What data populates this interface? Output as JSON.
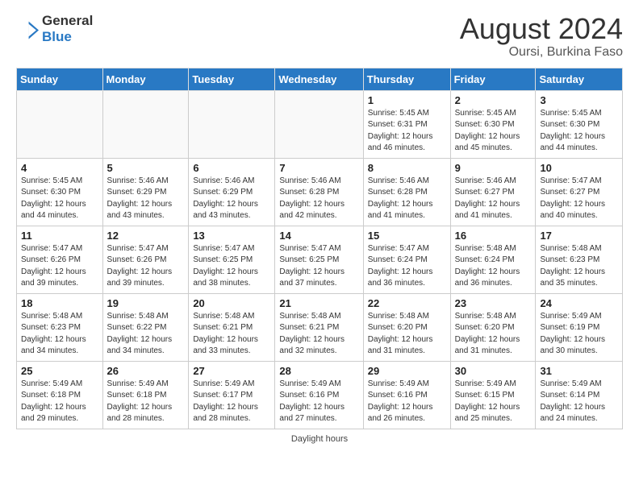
{
  "logo": {
    "line1": "General",
    "line2": "Blue"
  },
  "title": "August 2024",
  "location": "Oursi, Burkina Faso",
  "weekdays": [
    "Sunday",
    "Monday",
    "Tuesday",
    "Wednesday",
    "Thursday",
    "Friday",
    "Saturday"
  ],
  "weeks": [
    [
      {
        "day": "",
        "info": ""
      },
      {
        "day": "",
        "info": ""
      },
      {
        "day": "",
        "info": ""
      },
      {
        "day": "",
        "info": ""
      },
      {
        "day": "1",
        "info": "Sunrise: 5:45 AM\nSunset: 6:31 PM\nDaylight: 12 hours\nand 46 minutes."
      },
      {
        "day": "2",
        "info": "Sunrise: 5:45 AM\nSunset: 6:30 PM\nDaylight: 12 hours\nand 45 minutes."
      },
      {
        "day": "3",
        "info": "Sunrise: 5:45 AM\nSunset: 6:30 PM\nDaylight: 12 hours\nand 44 minutes."
      }
    ],
    [
      {
        "day": "4",
        "info": "Sunrise: 5:45 AM\nSunset: 6:30 PM\nDaylight: 12 hours\nand 44 minutes."
      },
      {
        "day": "5",
        "info": "Sunrise: 5:46 AM\nSunset: 6:29 PM\nDaylight: 12 hours\nand 43 minutes."
      },
      {
        "day": "6",
        "info": "Sunrise: 5:46 AM\nSunset: 6:29 PM\nDaylight: 12 hours\nand 43 minutes."
      },
      {
        "day": "7",
        "info": "Sunrise: 5:46 AM\nSunset: 6:28 PM\nDaylight: 12 hours\nand 42 minutes."
      },
      {
        "day": "8",
        "info": "Sunrise: 5:46 AM\nSunset: 6:28 PM\nDaylight: 12 hours\nand 41 minutes."
      },
      {
        "day": "9",
        "info": "Sunrise: 5:46 AM\nSunset: 6:27 PM\nDaylight: 12 hours\nand 41 minutes."
      },
      {
        "day": "10",
        "info": "Sunrise: 5:47 AM\nSunset: 6:27 PM\nDaylight: 12 hours\nand 40 minutes."
      }
    ],
    [
      {
        "day": "11",
        "info": "Sunrise: 5:47 AM\nSunset: 6:26 PM\nDaylight: 12 hours\nand 39 minutes."
      },
      {
        "day": "12",
        "info": "Sunrise: 5:47 AM\nSunset: 6:26 PM\nDaylight: 12 hours\nand 39 minutes."
      },
      {
        "day": "13",
        "info": "Sunrise: 5:47 AM\nSunset: 6:25 PM\nDaylight: 12 hours\nand 38 minutes."
      },
      {
        "day": "14",
        "info": "Sunrise: 5:47 AM\nSunset: 6:25 PM\nDaylight: 12 hours\nand 37 minutes."
      },
      {
        "day": "15",
        "info": "Sunrise: 5:47 AM\nSunset: 6:24 PM\nDaylight: 12 hours\nand 36 minutes."
      },
      {
        "day": "16",
        "info": "Sunrise: 5:48 AM\nSunset: 6:24 PM\nDaylight: 12 hours\nand 36 minutes."
      },
      {
        "day": "17",
        "info": "Sunrise: 5:48 AM\nSunset: 6:23 PM\nDaylight: 12 hours\nand 35 minutes."
      }
    ],
    [
      {
        "day": "18",
        "info": "Sunrise: 5:48 AM\nSunset: 6:23 PM\nDaylight: 12 hours\nand 34 minutes."
      },
      {
        "day": "19",
        "info": "Sunrise: 5:48 AM\nSunset: 6:22 PM\nDaylight: 12 hours\nand 34 minutes."
      },
      {
        "day": "20",
        "info": "Sunrise: 5:48 AM\nSunset: 6:21 PM\nDaylight: 12 hours\nand 33 minutes."
      },
      {
        "day": "21",
        "info": "Sunrise: 5:48 AM\nSunset: 6:21 PM\nDaylight: 12 hours\nand 32 minutes."
      },
      {
        "day": "22",
        "info": "Sunrise: 5:48 AM\nSunset: 6:20 PM\nDaylight: 12 hours\nand 31 minutes."
      },
      {
        "day": "23",
        "info": "Sunrise: 5:48 AM\nSunset: 6:20 PM\nDaylight: 12 hours\nand 31 minutes."
      },
      {
        "day": "24",
        "info": "Sunrise: 5:49 AM\nSunset: 6:19 PM\nDaylight: 12 hours\nand 30 minutes."
      }
    ],
    [
      {
        "day": "25",
        "info": "Sunrise: 5:49 AM\nSunset: 6:18 PM\nDaylight: 12 hours\nand 29 minutes."
      },
      {
        "day": "26",
        "info": "Sunrise: 5:49 AM\nSunset: 6:18 PM\nDaylight: 12 hours\nand 28 minutes."
      },
      {
        "day": "27",
        "info": "Sunrise: 5:49 AM\nSunset: 6:17 PM\nDaylight: 12 hours\nand 28 minutes."
      },
      {
        "day": "28",
        "info": "Sunrise: 5:49 AM\nSunset: 6:16 PM\nDaylight: 12 hours\nand 27 minutes."
      },
      {
        "day": "29",
        "info": "Sunrise: 5:49 AM\nSunset: 6:16 PM\nDaylight: 12 hours\nand 26 minutes."
      },
      {
        "day": "30",
        "info": "Sunrise: 5:49 AM\nSunset: 6:15 PM\nDaylight: 12 hours\nand 25 minutes."
      },
      {
        "day": "31",
        "info": "Sunrise: 5:49 AM\nSunset: 6:14 PM\nDaylight: 12 hours\nand 24 minutes."
      }
    ]
  ],
  "footer": {
    "daylight_label": "Daylight hours"
  }
}
